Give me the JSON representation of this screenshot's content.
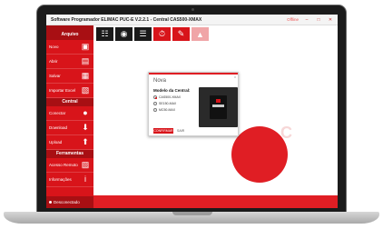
{
  "window": {
    "title": "Software Programador ELIMAC PUC-E V.2.2.1 - Central CAS500-XMAX",
    "online_label": "Offline",
    "minimize": "–",
    "maximize": "□",
    "close": "✕"
  },
  "sidebar": {
    "sections": [
      {
        "title": "Arquivo",
        "items": [
          {
            "label": "Novo",
            "icon": "new-file-icon",
            "glyph": "▣"
          },
          {
            "label": "Abrir",
            "icon": "folder-icon",
            "glyph": "▤"
          },
          {
            "label": "Salvar",
            "icon": "floppy-icon",
            "glyph": "▦"
          },
          {
            "label": "Importar Excel",
            "icon": "excel-icon",
            "glyph": "▧"
          }
        ]
      },
      {
        "title": "Central",
        "items": [
          {
            "label": "Conectar",
            "icon": "connect-icon",
            "glyph": "●"
          },
          {
            "label": "Download",
            "icon": "download-icon",
            "glyph": "⬇"
          },
          {
            "label": "Upload",
            "icon": "upload-icon",
            "glyph": "⬆"
          }
        ]
      },
      {
        "title": "Ferramentas",
        "items": [
          {
            "label": "Acesso Remoto",
            "icon": "remote-icon",
            "glyph": "▨"
          },
          {
            "label": "Informações",
            "icon": "info-icon",
            "glyph": "i"
          }
        ]
      }
    ],
    "status": "Desconectado"
  },
  "toolbar": {
    "buttons": [
      {
        "icon": "network-icon",
        "glyph": "☷"
      },
      {
        "icon": "target-icon",
        "glyph": "◉"
      },
      {
        "icon": "list-icon",
        "glyph": "☰"
      },
      {
        "icon": "timer-icon",
        "glyph": "⏱"
      },
      {
        "icon": "edit-icon",
        "glyph": "✎"
      },
      {
        "icon": "lock-icon",
        "glyph": "▲"
      }
    ]
  },
  "background": {
    "brand_text": "C"
  },
  "dialog": {
    "title": "Nova",
    "close": "x",
    "subtitle": "Modelo da Central:",
    "options": [
      {
        "label": "CAS500-XMAX",
        "selected": true
      },
      {
        "label": "SE150-MAX",
        "selected": false
      },
      {
        "label": "MC50-MAX",
        "selected": false
      }
    ],
    "confirm_label": "CONFIRMAR",
    "cancel_label": "SAIR"
  }
}
